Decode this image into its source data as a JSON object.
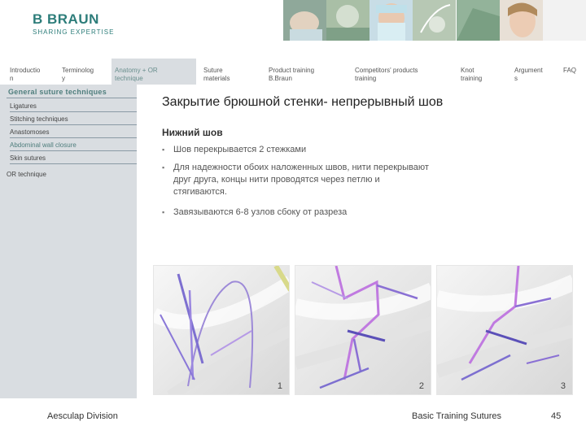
{
  "brand": {
    "name": "B BRAUN",
    "tagline": "SHARING EXPERTISE",
    "color": "#2d7d7a"
  },
  "topnav": [
    {
      "line1": "Introductio",
      "line2": "n"
    },
    {
      "line1": "Terminolog",
      "line2": "y"
    },
    {
      "line1": "Anatomy + OR",
      "line2": "technique"
    },
    {
      "line1": "Suture",
      "line2": "materials"
    },
    {
      "line1": "Product training",
      "line2": "B.Braun"
    },
    {
      "line1": "Competitors' products",
      "line2": "training"
    },
    {
      "line1": "Knot",
      "line2": "training"
    },
    {
      "line1": "Argument",
      "line2": "s"
    },
    {
      "line1": "FAQ",
      "line2": ""
    }
  ],
  "sidebar": {
    "heading": "General suture techniques",
    "items": [
      "Ligatures",
      "Stitching techniques",
      "Anastomoses",
      "Abdominal wall closure",
      "Skin sutures"
    ],
    "extra": "OR technique"
  },
  "main": {
    "title": "Закрытие брюшной стенки- непрерывный шов",
    "subheading": "Нижний шов",
    "bullets": [
      "Шов перекрывается 2 стежками",
      "Для надежности обоих наложенных швов, нити перекрывают друг друга, концы нити проводятся через петлю и стягиваются.",
      "Завязываются 6-8 узлов сбоку от разреза"
    ],
    "bullet_marker": "▪",
    "figures": [
      "1",
      "2",
      "3"
    ]
  },
  "footer": {
    "division": "Aesculap Division",
    "course": "Basic Training Sutures",
    "page": "45"
  },
  "colors": {
    "nav_active_bg": "#d9dde1",
    "accent_teal": "#4f7e7d",
    "suture_purple": "#8a6fd0",
    "suture_violet": "#c07ae0"
  }
}
